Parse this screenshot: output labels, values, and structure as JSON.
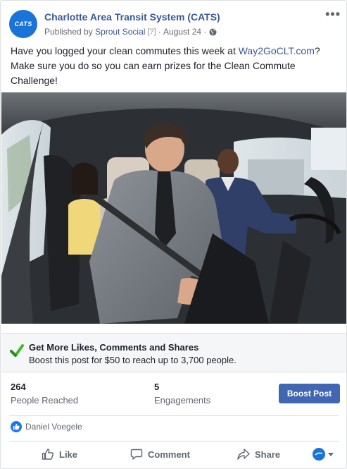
{
  "post": {
    "page_name": "Charlotte Area Transit System (CATS)",
    "avatar_text": "CATS",
    "published_by_prefix": "Published by",
    "publisher": "Sprout Social",
    "help_marker": "[?]",
    "separator": "·",
    "date": "August 24",
    "text_before_link": "Have you logged your clean commutes this week at ",
    "link_text": "Way2GoCLT.com",
    "text_after_link": "? Make sure you do so you can earn prizes for the Clean Commute Challenge!",
    "more_icon": "more-horizontal-icon",
    "audience_icon": "globe-icon"
  },
  "photo": {
    "icon": "photo-people-in-car"
  },
  "boost_banner": {
    "title": "Get More Likes, Comments and Shares",
    "subtitle": "Boost this post for $50 to reach up to 3,700 people.",
    "icon": "check-icon"
  },
  "stats": {
    "reached_value": "264",
    "reached_label": "People Reached",
    "engagements_value": "5",
    "engagements_label": "Engagements",
    "boost_button": "Boost Post"
  },
  "reactions": {
    "names": "Daniel Voegele",
    "icon": "like-icon"
  },
  "actions": {
    "like": "Like",
    "comment": "Comment",
    "share": "Share"
  },
  "colors": {
    "link_blue": "#385898",
    "button_blue": "#4267b2",
    "brand_blue": "#1a73d6",
    "check_green": "#42b72a"
  }
}
